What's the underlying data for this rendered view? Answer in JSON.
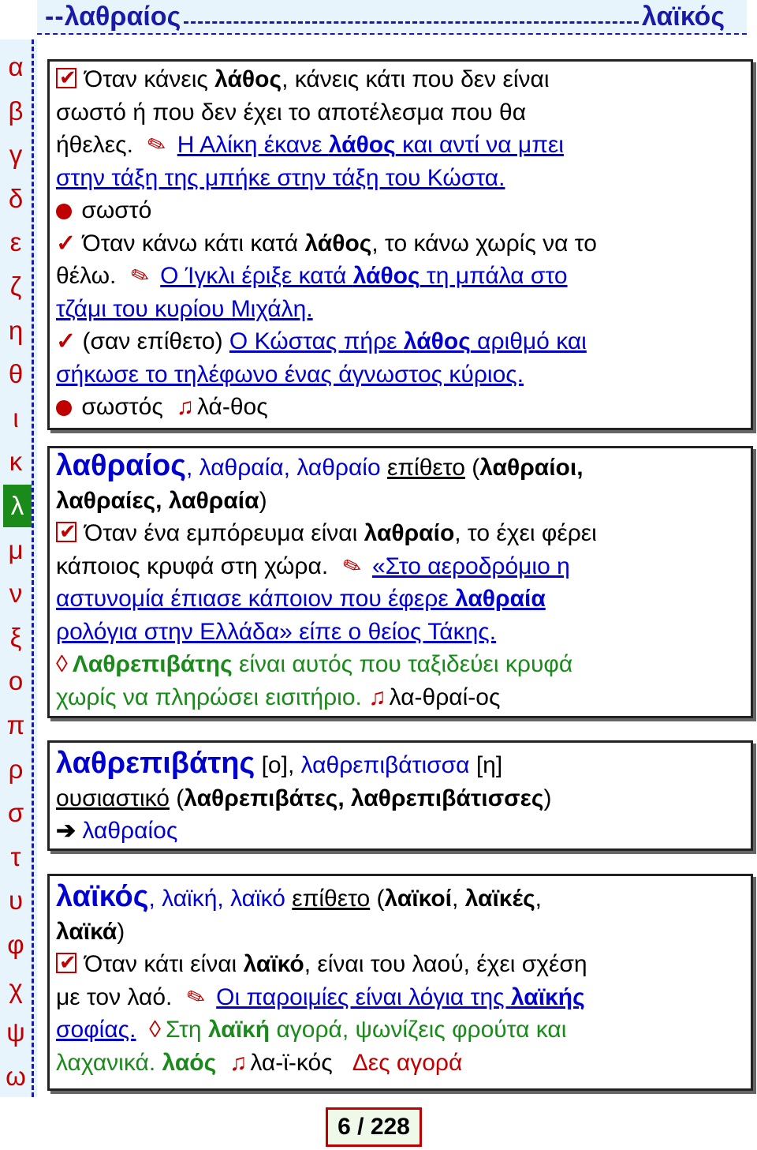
{
  "header": {
    "left_word": "λαθραίος",
    "right_word": "λαϊκός",
    "lead": "--"
  },
  "alphabet": {
    "letters": [
      "α",
      "β",
      "γ",
      "δ",
      "ε",
      "ζ",
      "η",
      "θ",
      "ι",
      "κ",
      "λ",
      "μ",
      "ν",
      "ξ",
      "ο",
      "π",
      "ρ",
      "σ",
      "τ",
      "υ",
      "φ",
      "χ",
      "ψ",
      "ω"
    ],
    "active": "λ"
  },
  "entry1": {
    "l1a": "Όταν κάνεις ",
    "l1b": "λάθος",
    "l1c": ", κάνεις κάτι που δεν είναι",
    "l2": "σωστό ή που δεν έχει το αποτέλεσμα που θα",
    "l3a": "ήθελες. ",
    "l3b": "Η Αλίκη έκανε ",
    "l3c": "λάθος",
    "l3d": " και αντί να μπει",
    "l4": "στην τάξη της μπήκε στην τάξη του Κώστα.",
    "l5": "σωστό",
    "l6a": "Όταν κάνω κάτι κατά ",
    "l6b": "λάθος",
    "l6c": ", το κάνω χωρίς να το",
    "l7a": "θέλω. ",
    "l7b": "Ο Ίγκλι έριξε κατά ",
    "l7c": "λάθος",
    "l7d": " τη μπάλα στο",
    "l8": "τζάμι του κυρίου Μιχάλη.",
    "l9a": "(σαν επίθετο) ",
    "l9b": "Ο Κώστας πήρε ",
    "l9c": "λάθος",
    "l9d": " αριθμό και",
    "l10": "σήκωσε το τηλέφωνο ένας άγνωστος κύριος.",
    "l11a": "σωστός",
    "l11b": "λά-θος"
  },
  "entry2": {
    "l1a": "λαθραίος",
    "l1b": ", λαθραία, λαθραίο ",
    "l1c": "επίθετο",
    "l1d": " (",
    "l1e": "λαθραίοι,",
    "l2a": "λαθραίες, λαθραία",
    "l2b": ")",
    "l3a": "Όταν ένα εμπόρευμα είναι ",
    "l3b": "λαθραίο",
    "l3c": ", το έχει φέρει",
    "l4a": "κάποιος κρυφά στη χώρα. ",
    "l4b": "«Στο αεροδρόμιο η",
    "l5a": "αστυνομία έπιασε κάποιον που έφερε ",
    "l5b": "λαθραία",
    "l6": "ρολόγια στην Ελλάδα» είπε ο θείος Τάκης.",
    "l7a": "Λαθρεπιβάτης",
    "l7b": " είναι αυτός που ταξιδεύει κρυφά",
    "l8a": "χωρίς να πληρώσει εισιτήριο. ",
    "l8b": "λα-θραί-ος"
  },
  "entry3": {
    "l1a": "λαθρεπιβάτης",
    "l1b": " [ο], ",
    "l1c": "λαθρεπιβάτισσα",
    "l1d": " [η]",
    "l2a": "ουσιαστικό",
    "l2b": " (",
    "l2c": "λαθρεπιβάτες, λαθρεπιβάτισσες",
    "l2d": ")",
    "l3": "λαθραίος"
  },
  "entry4": {
    "l1a": "λαϊκός",
    "l1b": ", λαϊκή, λαϊκό ",
    "l1c": "επίθετο",
    "l1d": " (",
    "l1e": "λαϊκοί",
    "l1f": ", ",
    "l1g": "λαϊκές",
    "l1h": ",",
    "l2a": "λαϊκά",
    "l2b": ")",
    "l3a": "Όταν κάτι είναι ",
    "l3b": "λαϊκό",
    "l3c": ", είναι του λαού, έχει σχέση",
    "l4a": "με τον λαό. ",
    "l4b": "Οι παροιμίες είναι λόγια της ",
    "l4c": "λαϊκής",
    "l5a": "σοφίας.",
    "l5b": "Στη ",
    "l5c": "λαϊκή",
    "l5d": " αγορά, ψωνίζεις φρούτα και",
    "l6a": "λαχανικά. ",
    "l6b": "λαός",
    "l6c": "λα-ϊ-κός",
    "l6d": "Δες αγορά"
  },
  "page": {
    "indicator": "6 / 228"
  },
  "colors": {
    "accent_blue": "#1a1aa8",
    "link_blue": "#0000d0",
    "red": "#c00000",
    "green": "#1a8a1a",
    "panel": "#e8f4fb"
  },
  "icons": [
    "checkbox-check-icon",
    "pencil-icon",
    "red-dot-icon",
    "check-icon",
    "music-note-icon",
    "diamond-icon",
    "arrow-right-icon"
  ]
}
